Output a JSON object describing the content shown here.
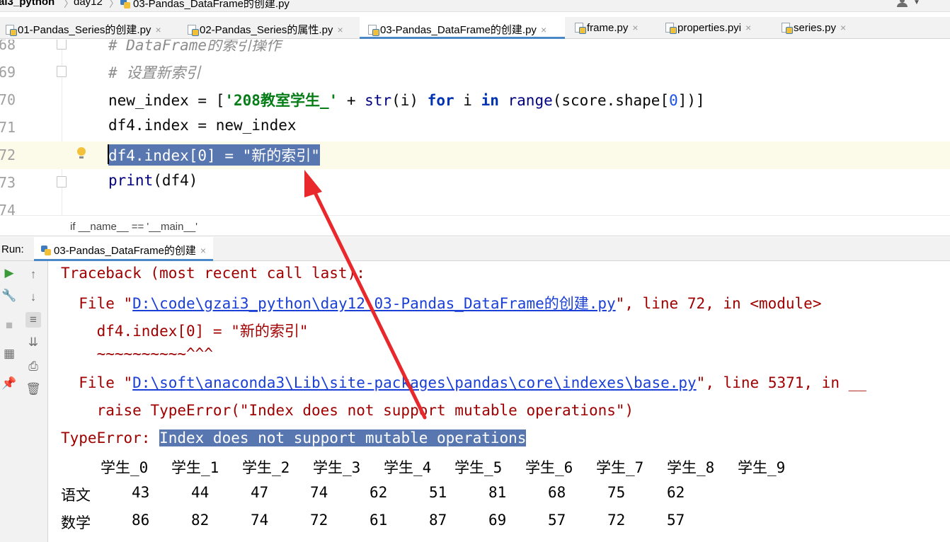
{
  "navbar": {
    "project": "ai3_python",
    "folder": "day12",
    "file": "03-Pandas_DataFrame的创建.py"
  },
  "tabs": [
    {
      "label": "01-Pandas_Series的创建.py",
      "active": false
    },
    {
      "label": "02-Pandas_Series的属性.py",
      "active": false
    },
    {
      "label": "03-Pandas_DataFrame的创建.py",
      "active": true
    },
    {
      "label": "frame.py",
      "active": false
    },
    {
      "label": "properties.pyi",
      "active": false
    },
    {
      "label": "series.py",
      "active": false
    }
  ],
  "tab_close_glyph": "×",
  "editor": {
    "lines": [
      {
        "num": "68",
        "text": "# DataFrame的索引操作"
      },
      {
        "num": "69",
        "text": "# 设置新索引"
      },
      {
        "num": "70",
        "parts": [
          "new_index = [",
          "'208教室学生_'",
          " + ",
          "str",
          "(i) ",
          "for",
          " i ",
          "in",
          " ",
          "range",
          "(score.shape[",
          "0",
          "])]"
        ]
      },
      {
        "num": "71",
        "text": "df4.index = new_index"
      },
      {
        "num": "72",
        "text": "df4.index[0] = \"新的索引\""
      },
      {
        "num": "73",
        "parts": [
          "print",
          "(df4)"
        ]
      },
      {
        "num": "74",
        "text": ""
      }
    ]
  },
  "code_breadcrumb": "if __name__ == '__main__'",
  "run": {
    "label": "Run:",
    "tab": "03-Pandas_DataFrame的创建"
  },
  "console": {
    "traceback_header": "Traceback (most recent call last):",
    "frame1_prefix": "  File \"",
    "frame1_path": "D:\\code\\gzai3_python\\day12\\03-Pandas_DataFrame的创建.py",
    "frame1_suffix": "\", line 72, in <module>",
    "frame1_code": "    df4.index[0] = \"新的索引\"",
    "frame1_marker": "    ~~~~~~~~~~^^^",
    "frame2_prefix": "  File \"",
    "frame2_path": "D:\\soft\\anaconda3\\Lib\\site-packages\\pandas\\core\\indexes\\base.py",
    "frame2_suffix": "\", line 5371, in __",
    "frame2_code": "    raise TypeError(\"Index does not support mutable operations\")",
    "error_type": "TypeError: ",
    "error_msg": "Index does not support mutable operations",
    "df_columns": [
      "学生_0",
      "学生_1",
      "学生_2",
      "学生_3",
      "学生_4",
      "学生_5",
      "学生_6",
      "学生_7",
      "学生_8",
      "学生_9"
    ],
    "df_rows": [
      {
        "label": "语文",
        "values": [
          "43",
          "44",
          "47",
          "74",
          "62",
          "51",
          "81",
          "68",
          "75",
          "62"
        ]
      },
      {
        "label": "数学",
        "values": [
          "86",
          "82",
          "74",
          "72",
          "61",
          "87",
          "69",
          "57",
          "72",
          "57"
        ]
      }
    ]
  },
  "colors": {
    "selection": "#5877b0",
    "error_text": "#a00000",
    "link": "#1a3fd6",
    "arrow": "#e8282b",
    "keyword": "#0033b3",
    "string": "#067d17"
  }
}
